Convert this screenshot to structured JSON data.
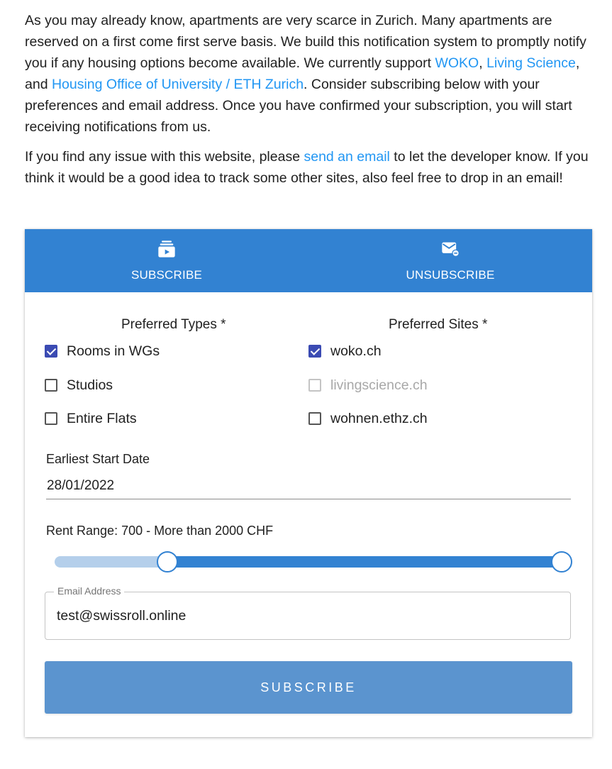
{
  "intro": {
    "p1_a": "As you may already know, apartments are very scarce in Zurich. Many apartments are reserved on a first come first serve basis. We build this notification system to promptly notify you if any housing options become available. We currently support ",
    "link_woko": "WOKO",
    "p1_b": ", ",
    "link_living": "Living Science",
    "p1_c": ", and ",
    "link_housing": "Housing Office of University / ETH Zurich",
    "p1_d": ". Consider subscribing below with your preferences and email address. Once you have confirmed your subscription, you will start receiving notifications from us.",
    "p2_a": "If you find any issue with this website, please ",
    "link_email": "send an email",
    "p2_b": " to let the developer know. If you think it would be a good idea to track some other sites, also feel free to drop in an email!"
  },
  "tabs": [
    {
      "label": "SUBSCRIBE",
      "icon": "subscriptions-icon"
    },
    {
      "label": "UNSUBSCRIBE",
      "icon": "unsubscribe-mail-icon"
    }
  ],
  "form": {
    "types_title": "Preferred Types *",
    "sites_title": "Preferred Sites *",
    "types": [
      {
        "label": "Rooms in WGs",
        "checked": true,
        "disabled": false
      },
      {
        "label": "Studios",
        "checked": false,
        "disabled": false
      },
      {
        "label": "Entire Flats",
        "checked": false,
        "disabled": false
      }
    ],
    "sites": [
      {
        "label": "woko.ch",
        "checked": true,
        "disabled": false
      },
      {
        "label": "livingscience.ch",
        "checked": false,
        "disabled": true
      },
      {
        "label": "wohnen.ethz.ch",
        "checked": false,
        "disabled": false
      }
    ],
    "date_label": "Earliest Start Date",
    "date_value": "28/01/2022",
    "rent_label": "Rent Range: 700 - More than 2000 CHF",
    "rent_range": {
      "low_fraction": 0.2225,
      "high_fraction": 1.0
    },
    "email_label": "Email Address",
    "email_value": "test@swissroll.online",
    "submit_label": "SUBSCRIBE"
  },
  "colors": {
    "primary": "#3282d2",
    "link": "#2196f3",
    "checkbox": "#3b4bb3",
    "button": "#5b94cf"
  }
}
